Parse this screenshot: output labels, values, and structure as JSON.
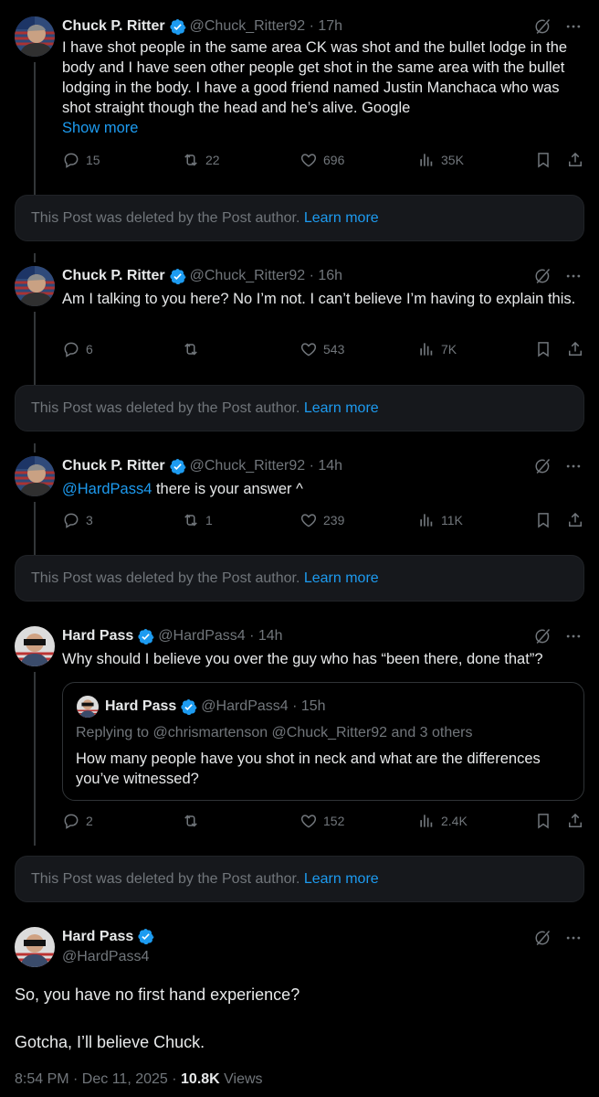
{
  "posts": [
    {
      "name": "Chuck P. Ritter",
      "handle": "@Chuck_Ritter92",
      "time": "· 17h",
      "text": "I have shot people in the same area CK was shot and the bullet lodge in the body and I have seen other people get shot in the same area with the bullet lodging in the body. I have a good friend named Justin Manchaca who was shot straight though the head and he’s alive. Google",
      "show_more": "Show more",
      "replies": "15",
      "reposts": "22",
      "likes": "696",
      "views": "35K"
    },
    {
      "name": "Chuck P. Ritter",
      "handle": "@Chuck_Ritter92",
      "time": "· 16h",
      "text": "Am I talking to you here? No I’m not. I can’t believe I’m having to explain this.",
      "replies": "6",
      "reposts": "",
      "likes": "543",
      "views": "7K"
    },
    {
      "name": "Chuck P. Ritter",
      "handle": "@Chuck_Ritter92",
      "time": "· 14h",
      "mention": "@HardPass4",
      "text": " there is your answer ^",
      "replies": "3",
      "reposts": "1",
      "likes": "239",
      "views": "11K"
    },
    {
      "name": "Hard Pass",
      "handle": "@HardPass4",
      "time": "· 14h",
      "text": "Why should I believe you over the guy who has “been there, done that”?",
      "quote": {
        "name": "Hard Pass",
        "handle": "@HardPass4",
        "time": "· 15h",
        "replying": "Replying to @chrismartenson @Chuck_Ritter92 and 3 others",
        "text": "How many people have you shot in neck and what are the differences you’ve witnessed?"
      },
      "replies": "2",
      "reposts": "",
      "likes": "152",
      "views": "2.4K"
    }
  ],
  "deleted": {
    "text": "This Post was deleted by the Post author.",
    "link": "Learn more"
  },
  "main": {
    "name": "Hard Pass",
    "handle": "@HardPass4",
    "line1": "So, you have no first hand experience?",
    "line2": "Gotcha, I’ll believe Chuck.",
    "timestamp": "8:54 PM · Dec 11, 2025 · ",
    "views_count": "10.8K",
    "views_label": " Views"
  },
  "colors": {
    "background": "#000000",
    "accent": "#1d9bf0",
    "muted": "#71767b",
    "text": "#e7e9ea",
    "deleted_bg": "#16181c"
  },
  "icons": [
    "verified-badge-icon",
    "grok-icon",
    "more-icon",
    "reply-icon",
    "repost-icon",
    "like-icon",
    "views-icon",
    "bookmark-icon",
    "share-icon"
  ]
}
